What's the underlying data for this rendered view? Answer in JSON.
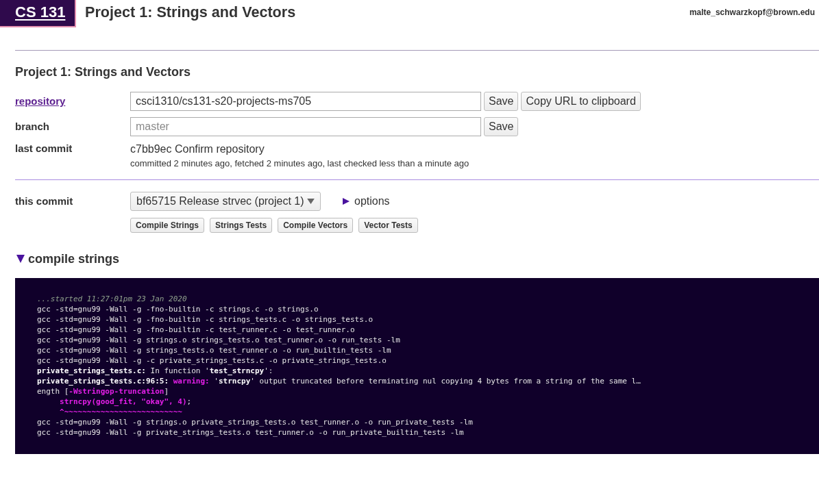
{
  "header": {
    "course": "CS 131",
    "title": "Project 1: Strings and Vectors",
    "user": "malte_schwarzkopf@brown.edu"
  },
  "project": {
    "heading": "Project 1: Strings and Vectors",
    "repository": {
      "label": "repository",
      "value": "csci1310/cs131-s20-projects-ms705",
      "save_button": "Save",
      "copy_button": "Copy URL to clipboard"
    },
    "branch": {
      "label": "branch",
      "placeholder": "master",
      "save_button": "Save"
    },
    "last_commit": {
      "label": "last commit",
      "commit": "c7bb9ec Confirm repository",
      "details": "committed 2 minutes ago, fetched 2 minutes ago, last checked less than a minute ago"
    }
  },
  "this_commit": {
    "label": "this commit",
    "select": "bf65715 Release strvec (project 1)",
    "options_toggle": {
      "label": "options",
      "expanded": false
    },
    "actions": [
      "Compile Strings",
      "Strings Tests",
      "Compile Vectors",
      "Vector Tests"
    ]
  },
  "output": {
    "title": "compile strings",
    "expanded": true,
    "lines": [
      [
        {
          "kind": "timestamp",
          "text": "...started 11:27:01pm 23 Jan 2020"
        }
      ],
      [
        {
          "kind": "plain",
          "text": "gcc -std=gnu99 -Wall -g -fno-builtin -c strings.c -o strings.o"
        }
      ],
      [
        {
          "kind": "plain",
          "text": "gcc -std=gnu99 -Wall -g -fno-builtin -c strings_tests.c -o strings_tests.o"
        }
      ],
      [
        {
          "kind": "plain",
          "text": "gcc -std=gnu99 -Wall -g -fno-builtin -c test_runner.c -o test_runner.o"
        }
      ],
      [
        {
          "kind": "plain",
          "text": "gcc -std=gnu99 -Wall -g strings.o strings_tests.o test_runner.o -o run_tests -lm"
        }
      ],
      [
        {
          "kind": "plain",
          "text": "gcc -std=gnu99 -Wall -g strings_tests.o test_runner.o -o run_builtin_tests -lm"
        }
      ],
      [
        {
          "kind": "plain",
          "text": "gcc -std=gnu99 -Wall -g -c private_strings_tests.c -o private_strings_tests.o"
        }
      ],
      [
        {
          "kind": "bold",
          "text": "private_strings_tests.c:"
        },
        {
          "kind": "plain",
          "text": " In function '"
        },
        {
          "kind": "bold",
          "text": "test_strncpy"
        },
        {
          "kind": "plain",
          "text": "':"
        }
      ],
      [
        {
          "kind": "bold",
          "text": "private_strings_tests.c:96:5: "
        },
        {
          "kind": "warning",
          "text": "warning:"
        },
        {
          "kind": "plain",
          "text": " '"
        },
        {
          "kind": "bold",
          "text": "strncpy"
        },
        {
          "kind": "plain",
          "text": "' output truncated before terminating nul copying 4 bytes from a string of the same l…"
        }
      ],
      [
        {
          "kind": "plain",
          "text": "ength ["
        },
        {
          "kind": "warning",
          "text": "-Wstringop-truncation"
        },
        {
          "kind": "plain",
          "text": "]"
        }
      ],
      [
        {
          "kind": "warning",
          "text": "     strncpy(good_fit, \"okay\", 4)"
        },
        {
          "kind": "plain",
          "text": ";"
        }
      ],
      [
        {
          "kind": "warning",
          "text": "     ^~~~~~~~~~~~~~~~~~~~~~~~~~~"
        }
      ],
      [
        {
          "kind": "plain",
          "text": "gcc -std=gnu99 -Wall -g strings.o private_strings_tests.o test_runner.o -o run_private_tests -lm"
        }
      ],
      [
        {
          "kind": "plain",
          "text": "gcc -std=gnu99 -Wall -g private_strings_tests.o test_runner.o -o run_private_builtin_tests -lm"
        }
      ]
    ]
  }
}
